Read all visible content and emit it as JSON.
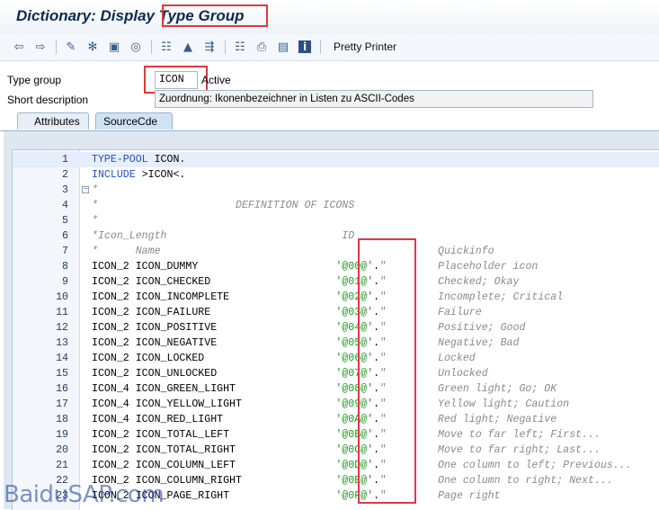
{
  "window": {
    "title_prefix": "Dictionary: Display ",
    "title_highlight": "Type Group"
  },
  "toolbar": {
    "icons": [
      "back-arrow-icon",
      "forward-arrow-icon",
      "other-object-icon",
      "display-change-icon",
      "activate-icon",
      "check-icon",
      "where-used-icon",
      "position-icon",
      "navigate-icon",
      "hierarchy-icon",
      "print-icon",
      "display-object-list-icon",
      "info-icon"
    ],
    "pretty_printer_label": "Pretty Printer"
  },
  "form": {
    "type_group_label": "Type group",
    "type_group_value": "ICON",
    "status": "Active",
    "short_desc_label": "Short description",
    "short_desc_value": "Zuordnung: Ikonenbezeichner in Listen zu ASCII-Codes"
  },
  "tabs": [
    {
      "label": "Attributes"
    },
    {
      "label": "SourceCde"
    }
  ],
  "code_lines": [
    {
      "n": "1",
      "parts": [
        [
          "kw",
          "TYPE-POOL"
        ],
        [
          "plain",
          " ICON."
        ]
      ],
      "q": ""
    },
    {
      "n": "2",
      "parts": [
        [
          "kw",
          "INCLUDE"
        ],
        [
          "plain",
          " >ICON<."
        ]
      ],
      "q": ""
    },
    {
      "n": "3",
      "parts": [
        [
          "cm",
          "*"
        ]
      ],
      "q": ""
    },
    {
      "n": "4",
      "parts": [
        [
          "cm",
          "*                      DEFINITION OF ICONS"
        ]
      ],
      "q": ""
    },
    {
      "n": "5",
      "parts": [
        [
          "cm",
          "*"
        ]
      ],
      "q": ""
    },
    {
      "n": "6",
      "parts": [
        [
          "cm",
          "*Icon_Length                            ID"
        ]
      ],
      "q": ""
    },
    {
      "n": "7",
      "parts": [
        [
          "cm",
          "*      Name"
        ]
      ],
      "q": "Quickinfo"
    },
    {
      "n": "8",
      "parts": [
        [
          "plain",
          "ICON_2 ICON_DUMMY                      "
        ],
        [
          "str",
          "'@00@'"
        ],
        [
          "plain",
          "."
        ],
        [
          "cm",
          "\""
        ]
      ],
      "q": "Placeholder icon"
    },
    {
      "n": "9",
      "parts": [
        [
          "plain",
          "ICON_2 ICON_CHECKED                    "
        ],
        [
          "str",
          "'@01@'"
        ],
        [
          "plain",
          "."
        ],
        [
          "cm",
          "\""
        ]
      ],
      "q": "Checked; Okay"
    },
    {
      "n": "10",
      "parts": [
        [
          "plain",
          "ICON_2 ICON_INCOMPLETE                 "
        ],
        [
          "str",
          "'@02@'"
        ],
        [
          "plain",
          "."
        ],
        [
          "cm",
          "\""
        ]
      ],
      "q": "Incomplete; Critical"
    },
    {
      "n": "11",
      "parts": [
        [
          "plain",
          "ICON_2 ICON_FAILURE                    "
        ],
        [
          "str",
          "'@03@'"
        ],
        [
          "plain",
          "."
        ],
        [
          "cm",
          "\""
        ]
      ],
      "q": "Failure"
    },
    {
      "n": "12",
      "parts": [
        [
          "plain",
          "ICON_2 ICON_POSITIVE                   "
        ],
        [
          "str",
          "'@04@'"
        ],
        [
          "plain",
          "."
        ],
        [
          "cm",
          "\""
        ]
      ],
      "q": "Positive; Good"
    },
    {
      "n": "13",
      "parts": [
        [
          "plain",
          "ICON_2 ICON_NEGATIVE                   "
        ],
        [
          "str",
          "'@05@'"
        ],
        [
          "plain",
          "."
        ],
        [
          "cm",
          "\""
        ]
      ],
      "q": "Negative; Bad"
    },
    {
      "n": "14",
      "parts": [
        [
          "plain",
          "ICON_2 ICON_LOCKED                     "
        ],
        [
          "str",
          "'@06@'"
        ],
        [
          "plain",
          "."
        ],
        [
          "cm",
          "\""
        ]
      ],
      "q": "Locked"
    },
    {
      "n": "15",
      "parts": [
        [
          "plain",
          "ICON_2 ICON_UNLOCKED                   "
        ],
        [
          "str",
          "'@07@'"
        ],
        [
          "plain",
          "."
        ],
        [
          "cm",
          "\""
        ]
      ],
      "q": "Unlocked"
    },
    {
      "n": "16",
      "parts": [
        [
          "plain",
          "ICON_4 ICON_GREEN_LIGHT                "
        ],
        [
          "str",
          "'@08@'"
        ],
        [
          "plain",
          "."
        ],
        [
          "cm",
          "\""
        ]
      ],
      "q": "Green light; Go; OK"
    },
    {
      "n": "17",
      "parts": [
        [
          "plain",
          "ICON_4 ICON_YELLOW_LIGHT               "
        ],
        [
          "str",
          "'@09@'"
        ],
        [
          "plain",
          "."
        ],
        [
          "cm",
          "\""
        ]
      ],
      "q": "Yellow light; Caution"
    },
    {
      "n": "18",
      "parts": [
        [
          "plain",
          "ICON_4 ICON_RED_LIGHT                  "
        ],
        [
          "str",
          "'@0A@'"
        ],
        [
          "plain",
          "."
        ],
        [
          "cm",
          "\""
        ]
      ],
      "q": "Red light; Negative"
    },
    {
      "n": "19",
      "parts": [
        [
          "plain",
          "ICON_2 ICON_TOTAL_LEFT                 "
        ],
        [
          "str",
          "'@0B@'"
        ],
        [
          "plain",
          "."
        ],
        [
          "cm",
          "\""
        ]
      ],
      "q": "Move to far left; First..."
    },
    {
      "n": "20",
      "parts": [
        [
          "plain",
          "ICON_2 ICON_TOTAL_RIGHT                "
        ],
        [
          "str",
          "'@0C@'"
        ],
        [
          "plain",
          "."
        ],
        [
          "cm",
          "\""
        ]
      ],
      "q": "Move to far right; Last..."
    },
    {
      "n": "21",
      "parts": [
        [
          "plain",
          "ICON_2 ICON_COLUMN_LEFT                "
        ],
        [
          "str",
          "'@0D@'"
        ],
        [
          "plain",
          "."
        ],
        [
          "cm",
          "\""
        ]
      ],
      "q": "One column to left; Previous..."
    },
    {
      "n": "22",
      "parts": [
        [
          "plain",
          "ICON_2 ICON_COLUMN_RIGHT               "
        ],
        [
          "str",
          "'@0E@'"
        ],
        [
          "plain",
          "."
        ],
        [
          "cm",
          "\""
        ]
      ],
      "q": "One column to right; Next..."
    },
    {
      "n": "23",
      "parts": [
        [
          "plain",
          "ICON_2 ICON_PAGE_RIGHT                 "
        ],
        [
          "str",
          "'@0F@'"
        ],
        [
          "plain",
          "."
        ],
        [
          "cm",
          "\""
        ]
      ],
      "q": "Page right"
    }
  ],
  "watermark": "BaiduSAP.com",
  "colors": {
    "highlight": "#e0383e",
    "keyword": "#2450c9",
    "string": "#1e9a1e",
    "comment": "#8a8a8a"
  }
}
